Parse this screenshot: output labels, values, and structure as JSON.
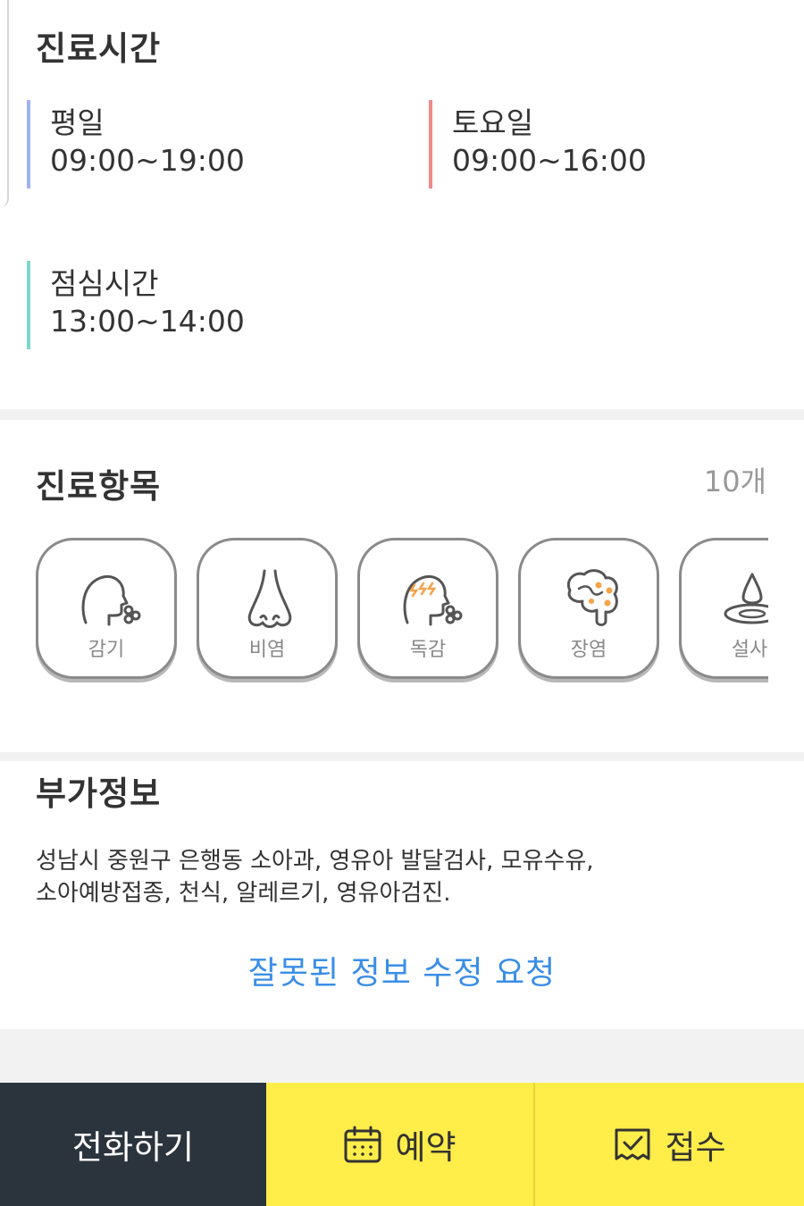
{
  "hours": {
    "title": "진료시간",
    "weekday": {
      "label": "평일",
      "time": "09:00~19:00"
    },
    "saturday": {
      "label": "토요일",
      "time": "09:00~16:00"
    },
    "lunch": {
      "label": "점심시간",
      "time": "13:00~14:00"
    }
  },
  "items": {
    "title": "진료항목",
    "count": "10개",
    "list": [
      {
        "name": "감기",
        "icon": "cold-icon"
      },
      {
        "name": "비염",
        "icon": "nose-icon"
      },
      {
        "name": "독감",
        "icon": "flu-icon"
      },
      {
        "name": "장염",
        "icon": "intestine-icon"
      },
      {
        "name": "설사",
        "icon": "drop-icon"
      }
    ]
  },
  "extra": {
    "title": "부가정보",
    "description": "성남시 중원구 은행동 소아과, 영유아 발달검사, 모유수유,\n소아예방접종, 천식, 알레르기, 영유아검진.",
    "edit_link": "잘못된 정보 수정 요청"
  },
  "bottom_bar": {
    "call": "전화하기",
    "reserve": "예약",
    "receipt": "접수"
  },
  "colors": {
    "weekday_bar": "#9fb4ee",
    "saturday_bar": "#ef8a8a",
    "lunch_bar": "#7fd6d0",
    "link": "#3a8ee6",
    "call_bg": "#2b333d",
    "action_bg": "#ffed4a",
    "icon_accent": "#f5a34a"
  }
}
